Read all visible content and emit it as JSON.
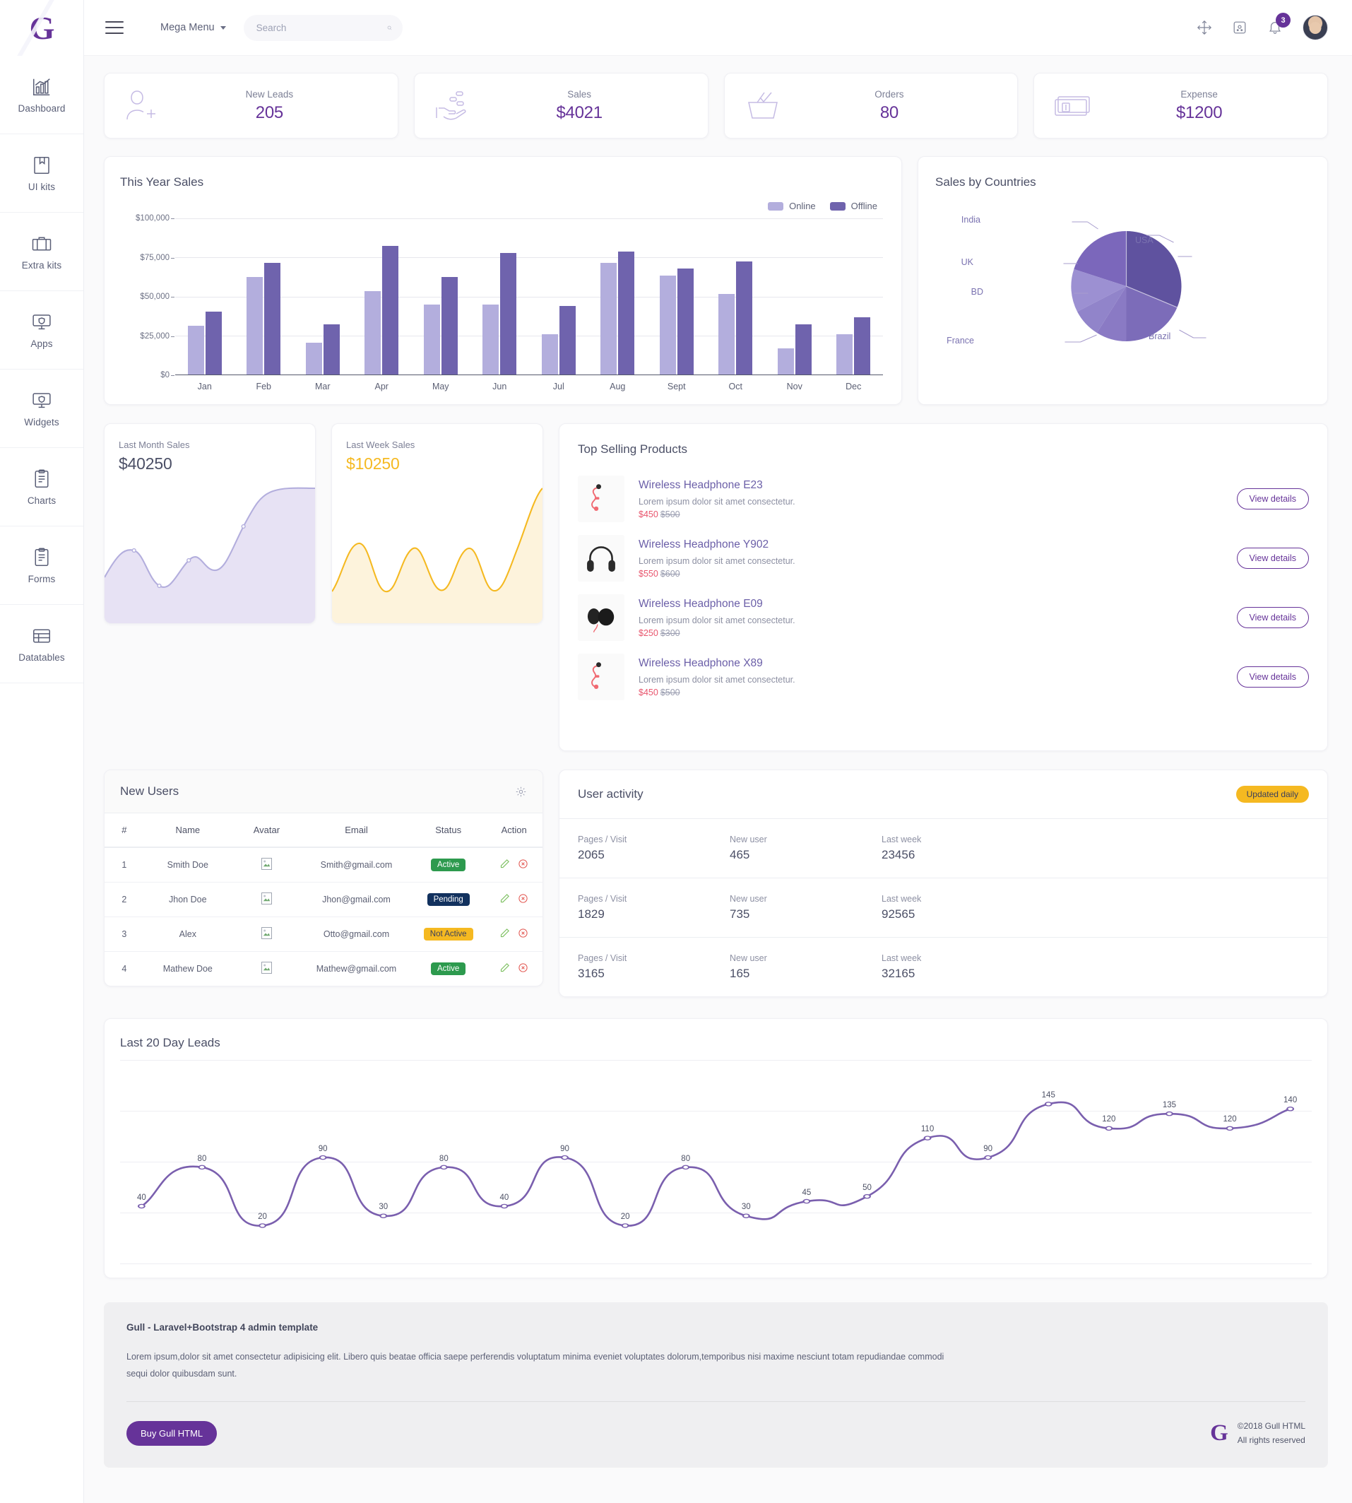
{
  "brand": {
    "logo_letter": "G"
  },
  "topbar": {
    "menu_icon": "hamburger-icon",
    "mega_menu_label": "Mega Menu",
    "search_placeholder": "Search",
    "search_value": "",
    "icons": [
      "fullscreen-icon",
      "apps-icon",
      "bell-icon"
    ],
    "notification_count": "3"
  },
  "sidebar": {
    "items": [
      {
        "label": "Dashboard",
        "icon": "bar-chart-icon"
      },
      {
        "label": "UI kits",
        "icon": "book-icon"
      },
      {
        "label": "Extra kits",
        "icon": "briefcase-icon"
      },
      {
        "label": "Apps",
        "icon": "monitor-shield-icon"
      },
      {
        "label": "Widgets",
        "icon": "monitor-shield-icon"
      },
      {
        "label": "Charts",
        "icon": "clipboard-icon"
      },
      {
        "label": "Forms",
        "icon": "clipboard-icon"
      },
      {
        "label": "Datatables",
        "icon": "table-icon"
      }
    ]
  },
  "stats": [
    {
      "label": "New Leads",
      "value": "205",
      "icon": "user-add-icon"
    },
    {
      "label": "Sales",
      "value": "$4021",
      "icon": "hand-coins-icon"
    },
    {
      "label": "Orders",
      "value": "80",
      "icon": "basket-check-icon"
    },
    {
      "label": "Expense",
      "value": "$1200",
      "icon": "money-stack-icon"
    }
  ],
  "colors": {
    "brand_purple": "#663399",
    "bar_online": "#b3aedd",
    "bar_offline": "#6f63ad",
    "line_purple": "#7a5fae",
    "yellow": "#f5b921",
    "price_red": "#e8556d",
    "green": "#2d9a4e",
    "navy": "#12315e"
  },
  "cards": {
    "this_year_sales": {
      "title": "This Year Sales"
    },
    "sales_by_countries": {
      "title": "Sales by Countries"
    },
    "last_month_sales": {
      "label": "Last Month Sales",
      "value": "$40250"
    },
    "last_week_sales": {
      "label": "Last Week Sales",
      "value": "$10250"
    },
    "top_selling": {
      "title": "Top Selling Products"
    },
    "new_users": {
      "title": "New Users",
      "settings_icon": "gear-icon"
    },
    "user_activity": {
      "title": "User activity",
      "badge": "Updated daily"
    },
    "leads": {
      "title": "Last 20 Day Leads"
    }
  },
  "chart_data": [
    {
      "type": "bar",
      "title": "This Year Sales",
      "categories": [
        "Jan",
        "Feb",
        "Mar",
        "Apr",
        "May",
        "Jun",
        "Jul",
        "Aug",
        "Sept",
        "Oct",
        "Nov",
        "Dec"
      ],
      "series": [
        {
          "name": "Online",
          "color": "#b3aedd",
          "values": [
            35000,
            70000,
            23000,
            60000,
            50000,
            50000,
            29000,
            80000,
            71000,
            58000,
            19000,
            29000
          ]
        },
        {
          "name": "Offline",
          "color": "#6f63ad",
          "values": [
            45000,
            80000,
            36000,
            92000,
            70000,
            87000,
            49000,
            88000,
            76000,
            81000,
            36000,
            41000
          ]
        }
      ],
      "ylabel": "",
      "xlabel": "",
      "yticks": [
        "$0",
        "$25,000",
        "$50,000",
        "$75,000",
        "$100,000"
      ],
      "ylim": [
        0,
        112000
      ],
      "grid": true,
      "legend": "top-right"
    },
    {
      "type": "pie",
      "title": "Sales by Countries",
      "labels": [
        "USA",
        "Brazil",
        "France",
        "BD",
        "UK",
        "India"
      ],
      "values": [
        25,
        17,
        14,
        10,
        8,
        26
      ],
      "colors": [
        "#5f529f",
        "#7c6cb9",
        "#8a7ac4",
        "#9184ca",
        "#9c90d2",
        "#7b67bb"
      ],
      "legend": "callout-labels"
    },
    {
      "type": "area",
      "title": "Last Month Sales",
      "values": [
        30,
        22,
        14,
        26,
        48,
        35,
        30,
        56,
        75,
        80
      ],
      "color": "#b3aedd",
      "fill": "#ece9f6"
    },
    {
      "type": "area",
      "title": "Last Week Sales",
      "values": [
        14,
        44,
        12,
        58,
        16,
        60,
        20,
        38,
        22,
        86
      ],
      "color": "#f5b921",
      "fill": "#fdf6e0"
    },
    {
      "type": "line",
      "title": "Last 20 Day Leads",
      "x": [
        1,
        2,
        3,
        4,
        5,
        6,
        7,
        8,
        9,
        10,
        11,
        12,
        13,
        14,
        15,
        16,
        17,
        18,
        19,
        20
      ],
      "values": [
        40,
        80,
        20,
        90,
        30,
        80,
        40,
        90,
        20,
        80,
        30,
        45,
        50,
        110,
        90,
        145,
        120,
        135,
        120,
        140
      ],
      "labels": [
        "40",
        "80",
        "20",
        "90",
        "30",
        "80",
        "40",
        "90",
        "20",
        "80",
        "30",
        "45",
        "50",
        "110",
        "90",
        "145",
        "120",
        "135",
        "120",
        "140"
      ],
      "color": "#7a5fae",
      "ylim": [
        0,
        170
      ],
      "grid": true,
      "show_point_labels": true
    }
  ],
  "products": [
    {
      "name": "Wireless Headphone E23",
      "desc": "Lorem ipsum dolor sit amet consectetur.",
      "price": "$450",
      "old_price": "$500",
      "button": "View details",
      "image": "earbuds-red-icon"
    },
    {
      "name": "Wireless Headphone Y902",
      "desc": "Lorem ipsum dolor sit amet consectetur.",
      "price": "$550",
      "old_price": "$600",
      "button": "View details",
      "image": "headphones-black-icon"
    },
    {
      "name": "Wireless Headphone E09",
      "desc": "Lorem ipsum dolor sit amet consectetur.",
      "price": "$250",
      "old_price": "$300",
      "button": "View details",
      "image": "headphones-dark-icon"
    },
    {
      "name": "Wireless Headphone X89",
      "desc": "Lorem ipsum dolor sit amet consectetur.",
      "price": "$450",
      "old_price": "$500",
      "button": "View details",
      "image": "earbuds-red-icon"
    }
  ],
  "users_table": {
    "columns": [
      "#",
      "Name",
      "Avatar",
      "Email",
      "Status",
      "Action"
    ],
    "rows": [
      {
        "num": "1",
        "name": "Smith Doe",
        "email": "Smith@gmail.com",
        "status": "Active",
        "status_type": "active"
      },
      {
        "num": "2",
        "name": "Jhon Doe",
        "email": "Jhon@gmail.com",
        "status": "Pending",
        "status_type": "pending"
      },
      {
        "num": "3",
        "name": "Alex",
        "email": "Otto@gmail.com",
        "status": "Not Active",
        "status_type": "notactive"
      },
      {
        "num": "4",
        "name": "Mathew Doe",
        "email": "Mathew@gmail.com",
        "status": "Active",
        "status_type": "active"
      }
    ],
    "action_icons": [
      "edit-pencil-icon",
      "delete-circle-icon"
    ]
  },
  "user_activity_rows": [
    {
      "l1": "Pages / Visit",
      "v1": "2065",
      "l2": "New user",
      "v2": "465",
      "l3": "Last week",
      "v3": "23456"
    },
    {
      "l1": "Pages / Visit",
      "v1": "1829",
      "l2": "New user",
      "v2": "735",
      "l3": "Last week",
      "v3": "92565"
    },
    {
      "l1": "Pages / Visit",
      "v1": "3165",
      "l2": "New user",
      "v2": "165",
      "l3": "Last week",
      "v3": "32165"
    }
  ],
  "footer": {
    "title": "Gull - Laravel+Bootstrap 4 admin template",
    "text": "Lorem ipsum,dolor sit amet consectetur adipisicing elit. Libero quis beatae officia saepe perferendis voluptatum minima eveniet voluptates dolorum,temporibus nisi maxime nesciunt totam repudiandae commodi sequi dolor quibusdam sunt.",
    "buy_button": "Buy Gull HTML",
    "copyright_line1": "©2018 Gull HTML",
    "copyright_line2": "All rights reserved",
    "logo_letter": "G"
  }
}
